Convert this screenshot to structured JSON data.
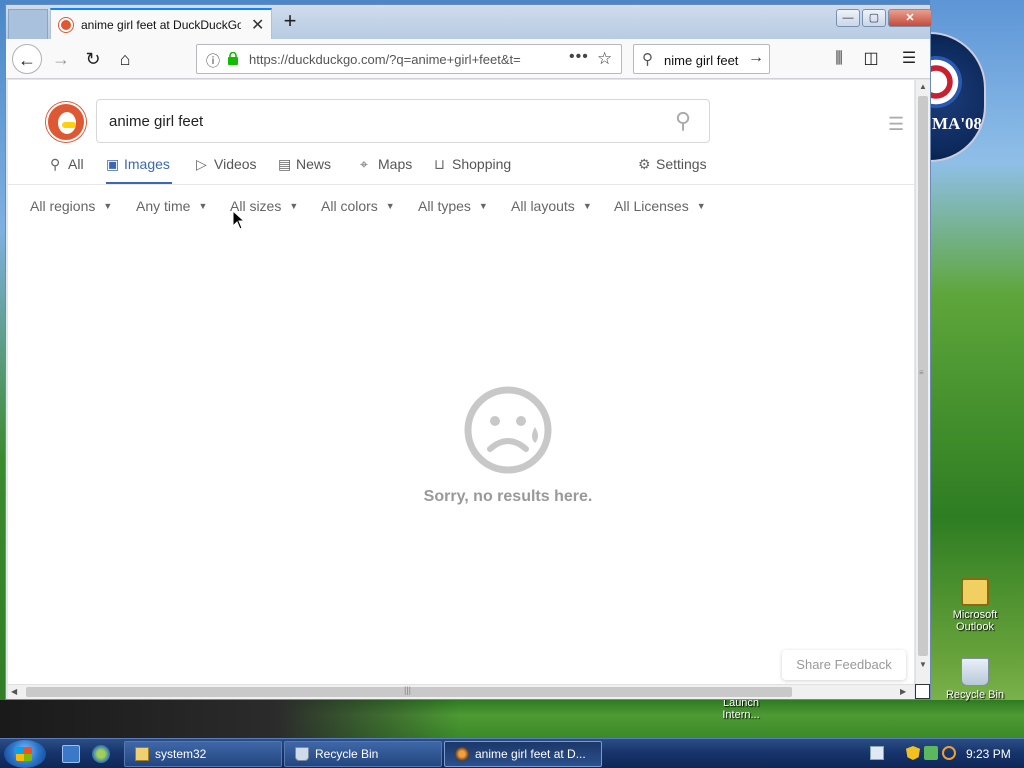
{
  "desktop": {
    "badge_text": "MA'08",
    "icons": [
      {
        "label": "Microsoft Outlook"
      },
      {
        "label": "Recycle Bin"
      }
    ],
    "partial_label": "Launch Intern..."
  },
  "browser": {
    "tab": {
      "title": "anime girl feet at DuckDuckGo",
      "close": "✕"
    },
    "new_tab": "+",
    "window_controls": {
      "minimize": "—",
      "maximize": "▢",
      "close": "✕"
    },
    "nav": {
      "back": "←",
      "forward": "→",
      "reload": "↻",
      "home": "⌂"
    },
    "url": "https://duckduckgo.com/?q=anime+girl+feet&t=",
    "url_more": "•••",
    "bookmark": "☆",
    "search_value": "nime girl feet",
    "search_go": "→",
    "toolbar": {
      "library": "⫼",
      "sidebar": "◫",
      "menu": "☰"
    }
  },
  "page": {
    "query": "anime girl feet",
    "tabs": [
      {
        "label": "All",
        "icon": "search-icon",
        "glyph": "⚲"
      },
      {
        "label": "Images",
        "icon": "image-icon",
        "glyph": "▣",
        "active": true
      },
      {
        "label": "Videos",
        "icon": "play-icon",
        "glyph": "▷"
      },
      {
        "label": "News",
        "icon": "news-icon",
        "glyph": "▤"
      },
      {
        "label": "Maps",
        "icon": "map-pin-icon",
        "glyph": "⌖"
      },
      {
        "label": "Shopping",
        "icon": "bag-icon",
        "glyph": "⊔"
      },
      {
        "label": "Settings",
        "icon": "sliders-icon",
        "glyph": "⚙"
      }
    ],
    "filters": [
      "All regions",
      "Any time",
      "All sizes",
      "All colors",
      "All types",
      "All layouts",
      "All Licenses"
    ],
    "no_results": "Sorry, no results here.",
    "share_feedback": "Share Feedback"
  },
  "taskbar": {
    "tasks": [
      {
        "label": "system32"
      },
      {
        "label": "Recycle Bin"
      },
      {
        "label": "anime girl feet at D...",
        "active": true
      }
    ],
    "clock": "9:23 PM"
  },
  "colors": {
    "accent": "#3b69b0",
    "ddg": "#de5833",
    "tab_highlight": "#0a84ff"
  }
}
